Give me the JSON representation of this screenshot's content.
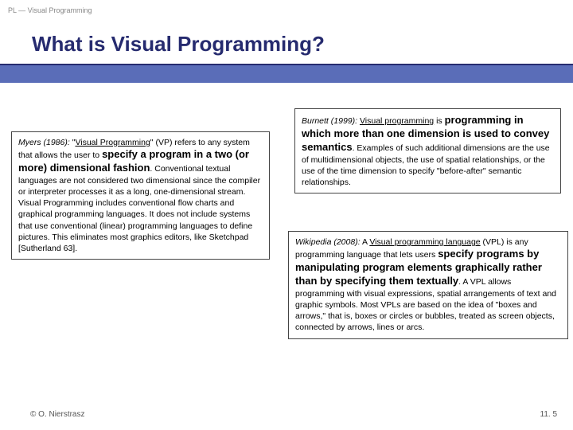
{
  "header": {
    "label": "PL — Visual Programming"
  },
  "title": "What is Visual Programming?",
  "left_box": {
    "lead_italic": "Myers (1986):",
    "lead_rest_a": " \"",
    "lead_underline": "Visual Programming",
    "lead_rest_b": "\" (VP) refers to any system that allows the user to ",
    "bold": "specify a program in a two (or more) dimensional fashion",
    "tail": ". Conventional textual languages are not considered two dimensional since the compiler or interpreter processes it as a long, one-dimensional stream. Visual Programming includes conventional flow charts and graphical programming languages. It does not include systems that use conventional (linear) programming languages to define pictures. This eliminates most graphics editors, like Sketchpad [Sutherland 63]."
  },
  "top_right_box": {
    "lead_italic": "Burnett (1999):",
    "lead_rest_a": " ",
    "lead_underline": "Visual programming",
    "lead_rest_b": " is ",
    "bold": "programming in which more than one dimension is used to convey semantics",
    "tail": ". Examples of such additional dimensions are the use of multidimensional objects, the use of spatial relationships, or the use of the time dimension to specify \"before-after\" semantic relationships."
  },
  "bottom_right_box": {
    "lead_italic": "Wikipedia (2008):",
    "lead_rest_a": " A ",
    "lead_underline": "Visual programming language",
    "lead_rest_b": " (VPL) is any programming language that lets users ",
    "bold": "specify programs by manipulating program elements graphically rather than by specifying them textually",
    "tail": ". A VPL allows programming with visual expressions, spatial arrangements of text and graphic symbols. Most VPLs are based on the idea of \"boxes and arrows,\" that is, boxes or circles or bubbles, treated as screen objects, connected by arrows, lines or arcs."
  },
  "footer": {
    "left": "© O. Nierstrasz",
    "right": "11. 5"
  }
}
